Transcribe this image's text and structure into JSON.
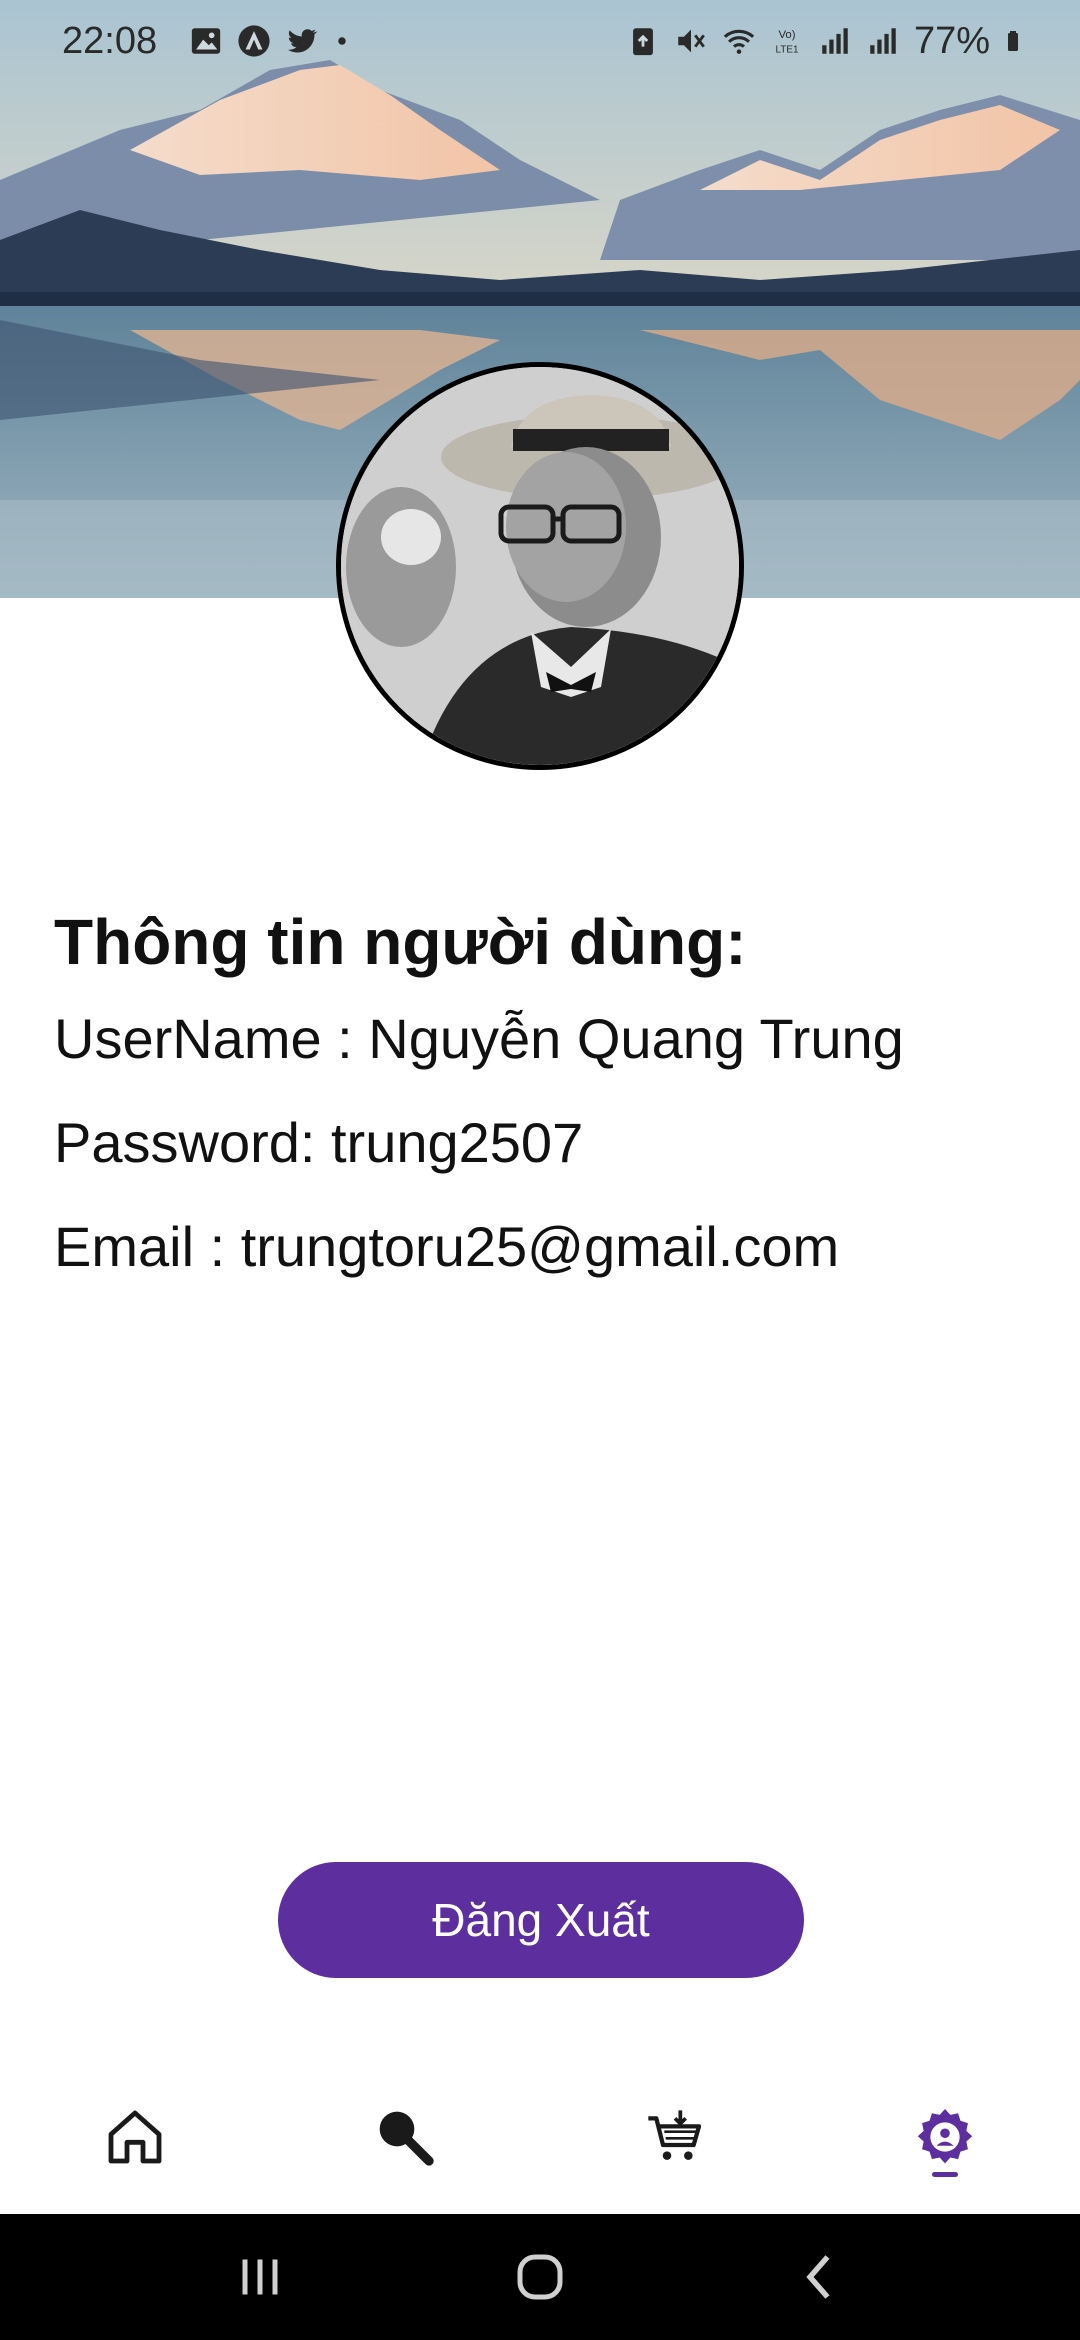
{
  "status_bar": {
    "time": "22:08",
    "battery_percent": "77%",
    "left_icons": [
      "gallery-icon",
      "app-icon",
      "twitter-icon",
      "dot-icon"
    ],
    "right_icons": [
      "recycle-icon",
      "mute-icon",
      "wifi-icon",
      "volte-icon",
      "signal-icon",
      "signal-icon",
      "battery-icon"
    ]
  },
  "profile": {
    "title": "Thông tin người dùng:",
    "username_line": "UserName : Nguyễn Quang Trung",
    "password_line": "Password: trung2507",
    "email_line": "Email :  trungtoru25@gmail.com"
  },
  "actions": {
    "logout_label": "Đăng Xuất"
  },
  "tabs": [
    {
      "name": "home",
      "icon": "home-icon",
      "active": false
    },
    {
      "name": "search",
      "icon": "search-icon",
      "active": false
    },
    {
      "name": "cart",
      "icon": "cart-icon",
      "active": false
    },
    {
      "name": "account-settings",
      "icon": "account-settings-icon",
      "active": true
    }
  ],
  "colors": {
    "accent": "#5c2e9e",
    "text": "#111111",
    "navbar": "#000000"
  }
}
